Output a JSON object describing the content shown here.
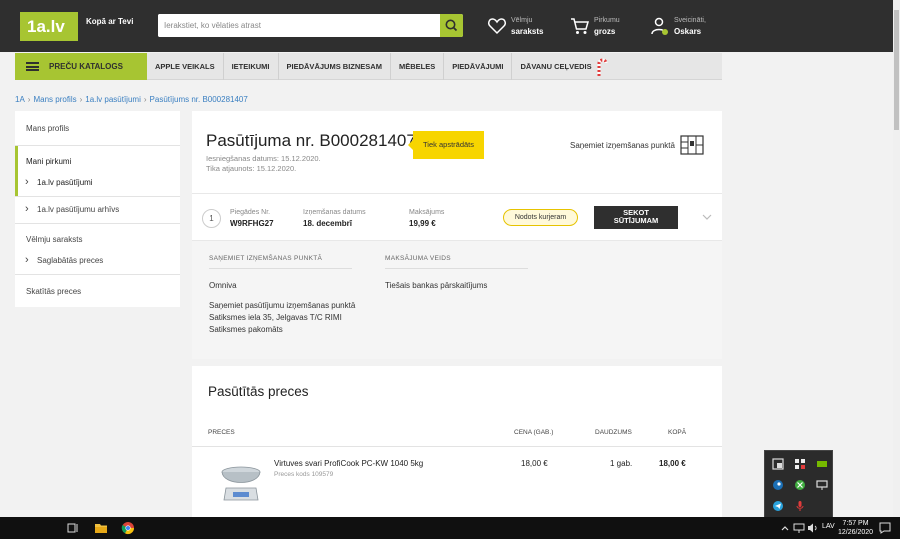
{
  "header": {
    "logo": "1a.lv",
    "tagline": "Kopā ar Tevi",
    "search_placeholder": "Ierakstiet, ko vēlaties atrast",
    "wishlist_top": "Vēlmju",
    "wishlist_bottom": "saraksts",
    "cart_top": "Pirkumu",
    "cart_bottom": "grozs",
    "user_top": "Sveicināti,",
    "user_bottom": "Oskars"
  },
  "nav": {
    "catalog": "PREČU KATALOGS",
    "items": [
      "APPLE VEIKALS",
      "IETEIKUMI",
      "PIEDĀVĀJUMS BIZNESAM",
      "MĒBELES",
      "PIEDĀVĀJUMI",
      "DĀVANU CEĻVEDIS"
    ]
  },
  "breadcrumb": [
    "1A",
    "Mans profils",
    "1a.lv pasūtījumi",
    "Pasūtījums nr. B000281407"
  ],
  "sidebar": {
    "profile": "Mans profils",
    "my_purchases": "Mani pirkumi",
    "orders": "1a.lv pasūtījumi",
    "orders_archive": "1a.lv pasūtījumu arhīvs",
    "wishlist": "Vēlmju saraksts",
    "saved": "Saglabātās preces",
    "viewed": "Skatītās preces"
  },
  "order": {
    "title": "Pasūtījuma nr. B000281407",
    "submitted": "Iesniegšanas datums: 15.12.2020.",
    "updated": "Tika atjaunots: 15.12.2020.",
    "status": "Tiek apstrādāts",
    "pickup_label": "Saņemiet izņemšanas punktā",
    "delivery": {
      "num": "1",
      "no_label": "Piegādes Nr.",
      "no_value": "W9RFHG27",
      "date_label": "Izņemšanas datums",
      "date_value": "18. decembrī",
      "pay_label": "Maksājums",
      "pay_value": "19,99 €",
      "badge": "Nodots kurjeram",
      "track_line1": "SEKOT",
      "track_line2": "SŪTĪJUMAM"
    },
    "details": {
      "pickup_head": "SAŅEMIET IZŅEMŠANAS PUNKTĀ",
      "pickup_provider": "Omniva",
      "pickup_line1": "Saņemiet pasūtījumu izņemšanas punktā",
      "pickup_line2": "Satiksmes iela 35, Jelgavas T/C RIMI",
      "pickup_line3": "Satiksmes pakomāts",
      "payment_head": "MAKSĀJUMA VEIDS",
      "payment_value": "Tiešais bankas pārskaitījums"
    }
  },
  "products": {
    "title": "Pasūtītās preces",
    "col_item": "PRECES",
    "col_price": "CENA (GAB.)",
    "col_qty": "DAUDZUMS",
    "col_total": "KOPĀ",
    "rows": [
      {
        "name": "Virtuves svari ProfiCook PC-KW 1040 5kg",
        "code": "Preces kods 109579",
        "price": "18,00 €",
        "qty": "1 gab.",
        "total": "18,00 €"
      }
    ]
  },
  "taskbar": {
    "lang": "LAV",
    "time": "7:57 PM",
    "date": "12/26/2020"
  },
  "colors": {
    "brand_green": "#a7c532",
    "header_dark": "#2f2f2f",
    "status_yellow": "#f7d500"
  }
}
